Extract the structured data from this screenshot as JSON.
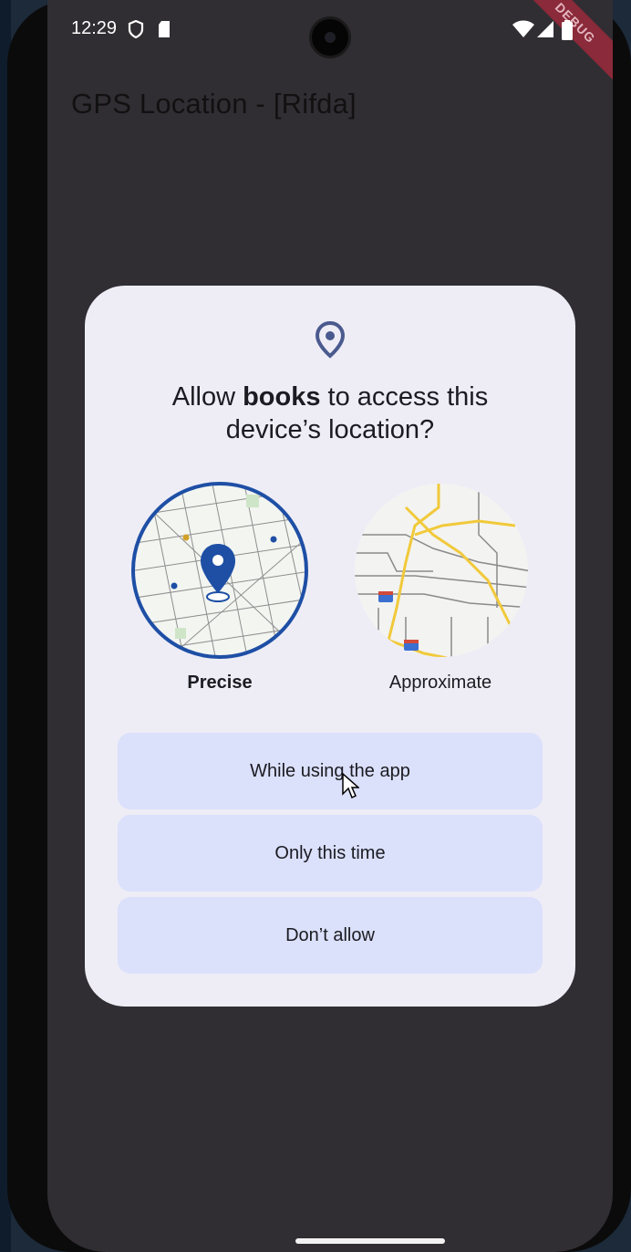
{
  "app": {
    "title": "GPS Location - [Rifda]",
    "debug_banner": "DEBUG"
  },
  "status_bar": {
    "time": "12:29",
    "icons": [
      "shield-icon",
      "sd-card-icon",
      "wifi-icon",
      "cell-signal-icon",
      "battery-icon"
    ]
  },
  "permission_dialog": {
    "icon": "location-pin-icon",
    "title_prefix": "Allow ",
    "app_name": "books",
    "title_suffix": " to access this device’s location?",
    "options": {
      "precise": "Precise",
      "approximate": "Approximate",
      "selected": "Precise"
    },
    "buttons": {
      "while_using": "While using the app",
      "only_this_time": "Only this time",
      "deny": "Don’t allow"
    }
  },
  "colors": {
    "dialog_bg": "#eeedf6",
    "button_bg": "#dbe0fb",
    "accent": "#1e4fa5",
    "screen_bg": "#302e33"
  }
}
